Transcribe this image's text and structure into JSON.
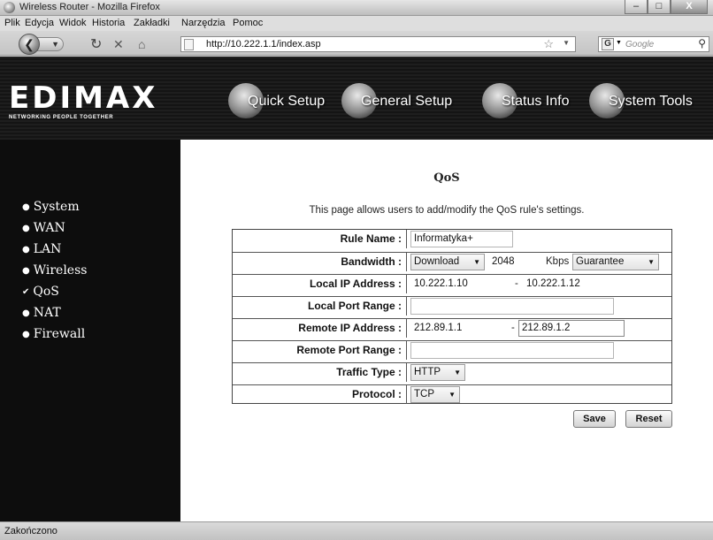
{
  "window": {
    "title": "Wireless Router - Mozilla Firefox"
  },
  "menu": [
    "Plik",
    "Edycja",
    "Widok",
    "Historia",
    "Zakładki",
    "Narzędzia",
    "Pomoc"
  ],
  "toolbar": {
    "url": "http://10.222.1.1/index.asp",
    "search_placeholder": "Google"
  },
  "header": {
    "logo": "EDIMAX",
    "tagline": "NETWORKING PEOPLE TOGETHER",
    "nav": [
      "Quick Setup",
      "General Setup",
      "Status Info",
      "System Tools"
    ]
  },
  "sidebar": [
    "System",
    "WAN",
    "LAN",
    "Wireless",
    "QoS",
    "NAT",
    "Firewall"
  ],
  "qos": {
    "title": "QoS",
    "description": "This page allows users to add/modify the QoS rule's settings.",
    "labels": {
      "rule_name": "Rule Name :",
      "bandwidth": "Bandwidth :",
      "local_ip": "Local IP Address :",
      "local_port": "Local Port Range :",
      "remote_ip": "Remote IP Address :",
      "remote_port": "Remote Port Range :",
      "traffic_type": "Traffic Type :",
      "protocol": "Protocol :"
    },
    "values": {
      "rule_name": "Informatyka+",
      "direction": "Download",
      "bandwidth": "2048",
      "unit": "Kbps",
      "mode": "Guarantee",
      "local_ip_from": "10.222.1.10",
      "local_ip_to": "10.222.1.12",
      "local_port": "",
      "remote_ip_from": "212.89.1.1",
      "remote_ip_to": "212.89.1.2",
      "remote_port": "",
      "traffic_type": "HTTP",
      "protocol": "TCP"
    },
    "separator": "-",
    "save": "Save",
    "reset": "Reset"
  },
  "status": "Zakończono"
}
